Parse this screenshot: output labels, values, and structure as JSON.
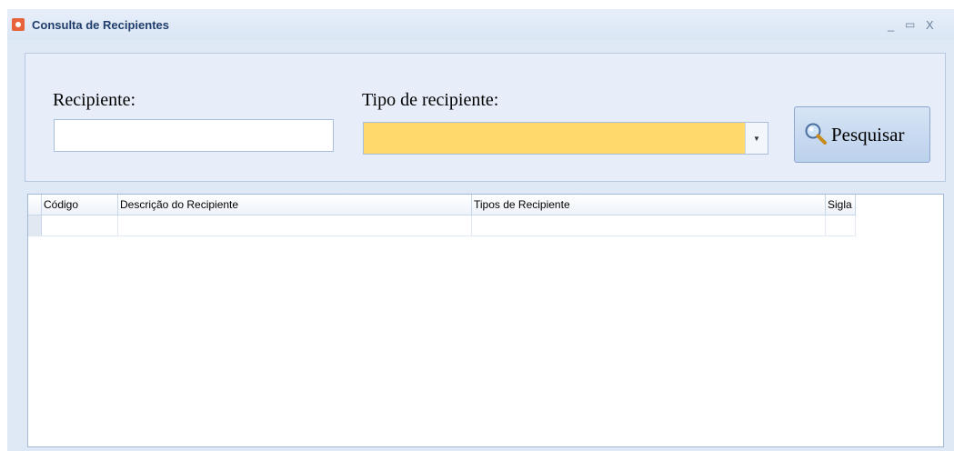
{
  "window": {
    "title": "Consulta de Recipientes",
    "controls": {
      "minimize": "_",
      "maximize": "▭",
      "close": "X"
    }
  },
  "filters": {
    "recipiente_label": "Recipiente:",
    "recipiente_value": "",
    "tipo_label": "Tipo de recipiente:",
    "tipo_selected": "",
    "combo_arrow": "▼",
    "search_button_label": "Pesquisar",
    "search_button_icon": "search-icon"
  },
  "grid": {
    "columns": [
      "Código",
      "Descrição do Recipiente",
      "Tipos de Recipiente",
      "Sigla"
    ],
    "rows": [
      {
        "codigo": "",
        "descricao": "",
        "tipos": "",
        "sigla": ""
      }
    ]
  },
  "colors": {
    "window_bg": "#dfe9f6",
    "combo_highlight": "#ffd96b",
    "title_text": "#1f3d6b"
  }
}
